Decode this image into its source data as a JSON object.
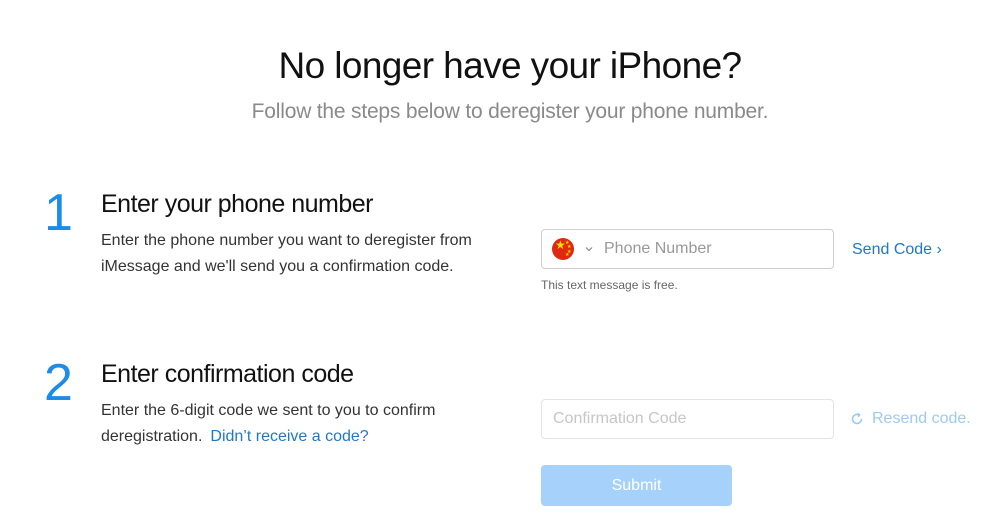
{
  "header": {
    "title": "No longer have your iPhone?",
    "subtitle": "Follow the steps below to deregister your phone number."
  },
  "steps": [
    {
      "number": "1",
      "heading": "Enter your phone number",
      "description": "Enter the phone number you want to deregister from iMessage and we'll send you a confirmation code."
    },
    {
      "number": "2",
      "heading": "Enter confirmation code",
      "description": "Enter the 6-digit code we sent to you to confirm deregistration.",
      "link_label": "Didn’t receive a code?"
    }
  ],
  "phone_form": {
    "country_flag_icon": "china-flag-icon",
    "phone_value": "",
    "phone_placeholder": "Phone Number",
    "hint": "This text message is free.",
    "send_code_label": "Send Code ›"
  },
  "code_form": {
    "code_value": "",
    "code_placeholder": "Confirmation Code",
    "resend_label": "Resend code.",
    "submit_label": "Submit"
  },
  "colors": {
    "accent": "#1e8be6",
    "link": "#1e78c8",
    "submit_disabled": "#a6d1fa",
    "resend_disabled": "#9ccaf0"
  }
}
